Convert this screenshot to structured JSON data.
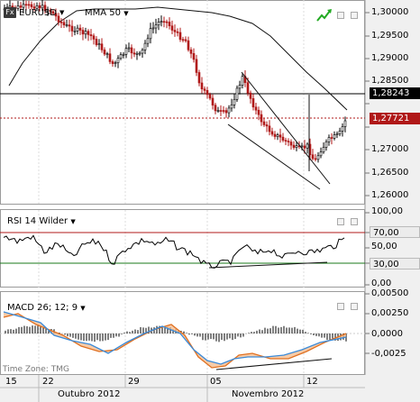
{
  "main_panel": {
    "symbol": "EURUSD",
    "indicator": "MMA 50",
    "price_ticks": [
      "1,30000",
      "1,29500",
      "1,29000",
      "1,28500",
      "1,28000",
      "1,27500",
      "1,27000",
      "1,26500",
      "1,26000"
    ],
    "line_price": "1,28243",
    "current_price": "1,27721"
  },
  "rsi_panel": {
    "title": "RSI 14 Wilder",
    "ticks": [
      "100,00",
      "70,00",
      "50,00",
      "30,00",
      "0,00"
    ],
    "upper_level": "70,00",
    "lower_level": "30,00"
  },
  "macd_panel": {
    "title": "MACD 26; 12; 9",
    "ticks": [
      "0,00500",
      "0,00250",
      "0,0000",
      "-0,0025"
    ],
    "timezone": "Time Zone: TMG"
  },
  "x_axis": {
    "days": [
      "15",
      "22",
      "29",
      "05",
      "12"
    ],
    "months": [
      "Outubro 2012",
      "Novembro 2012"
    ]
  },
  "colors": {
    "bull_candle": "#000000",
    "bear_candle": "#b01818",
    "rsi_upper_line": "#b01818",
    "rsi_lower_line": "#1a7a1a",
    "macd_line": "#e07020",
    "signal_line": "#3a8ad8",
    "histogram": "#000000",
    "trend_icon": "#22aa22"
  },
  "icons": [
    "fx-icon",
    "dropdown-caret-icon",
    "trend-up-icon",
    "minimize-icon",
    "maximize-icon"
  ]
}
